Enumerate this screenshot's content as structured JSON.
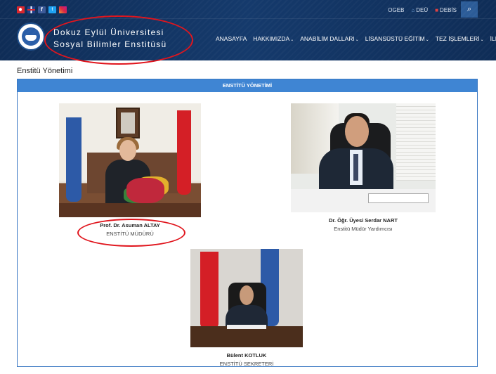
{
  "header": {
    "top_links": {
      "ogeb": "OGEB",
      "deu": "DEÜ",
      "debis": "DEBİS"
    },
    "brand_line1": "Dokuz Eylül Üniversitesi",
    "brand_line2": "Sosyal Bilimler Enstitüsü",
    "nav": [
      {
        "label": "ANASAYFA",
        "caret": ""
      },
      {
        "label": "HAKKIMIZDA",
        "caret": "⌄"
      },
      {
        "label": "ANABİLİM DALLARI",
        "caret": "⌄"
      },
      {
        "label": "LİSANSÜSTÜ EĞİTİM",
        "caret": "⌄"
      },
      {
        "label": "TEZ İŞLEMLERİ",
        "caret": "⌄"
      },
      {
        "label": "İLETİŞİM",
        "caret": "⌄"
      }
    ],
    "colors": {
      "bar": "#153a6c",
      "accent": "#2c5c98",
      "annotation": "#e0141c"
    }
  },
  "page": {
    "title": "Enstitü Yönetimi",
    "panel_title": "ENSTİTÜ YÖNETİMİ"
  },
  "people": [
    {
      "name": "Prof. Dr. Asuman ALTAY",
      "role": "ENSTİTÜ MÜDÜRÜ"
    },
    {
      "name": "Dr. Öğr. Üyesi Serdar NART",
      "role": "Enstitü Müdür Yardımcısı"
    },
    {
      "name": "Bülent KOTLUK",
      "role": "ENSTİTÜ SEKRETERİ"
    }
  ]
}
